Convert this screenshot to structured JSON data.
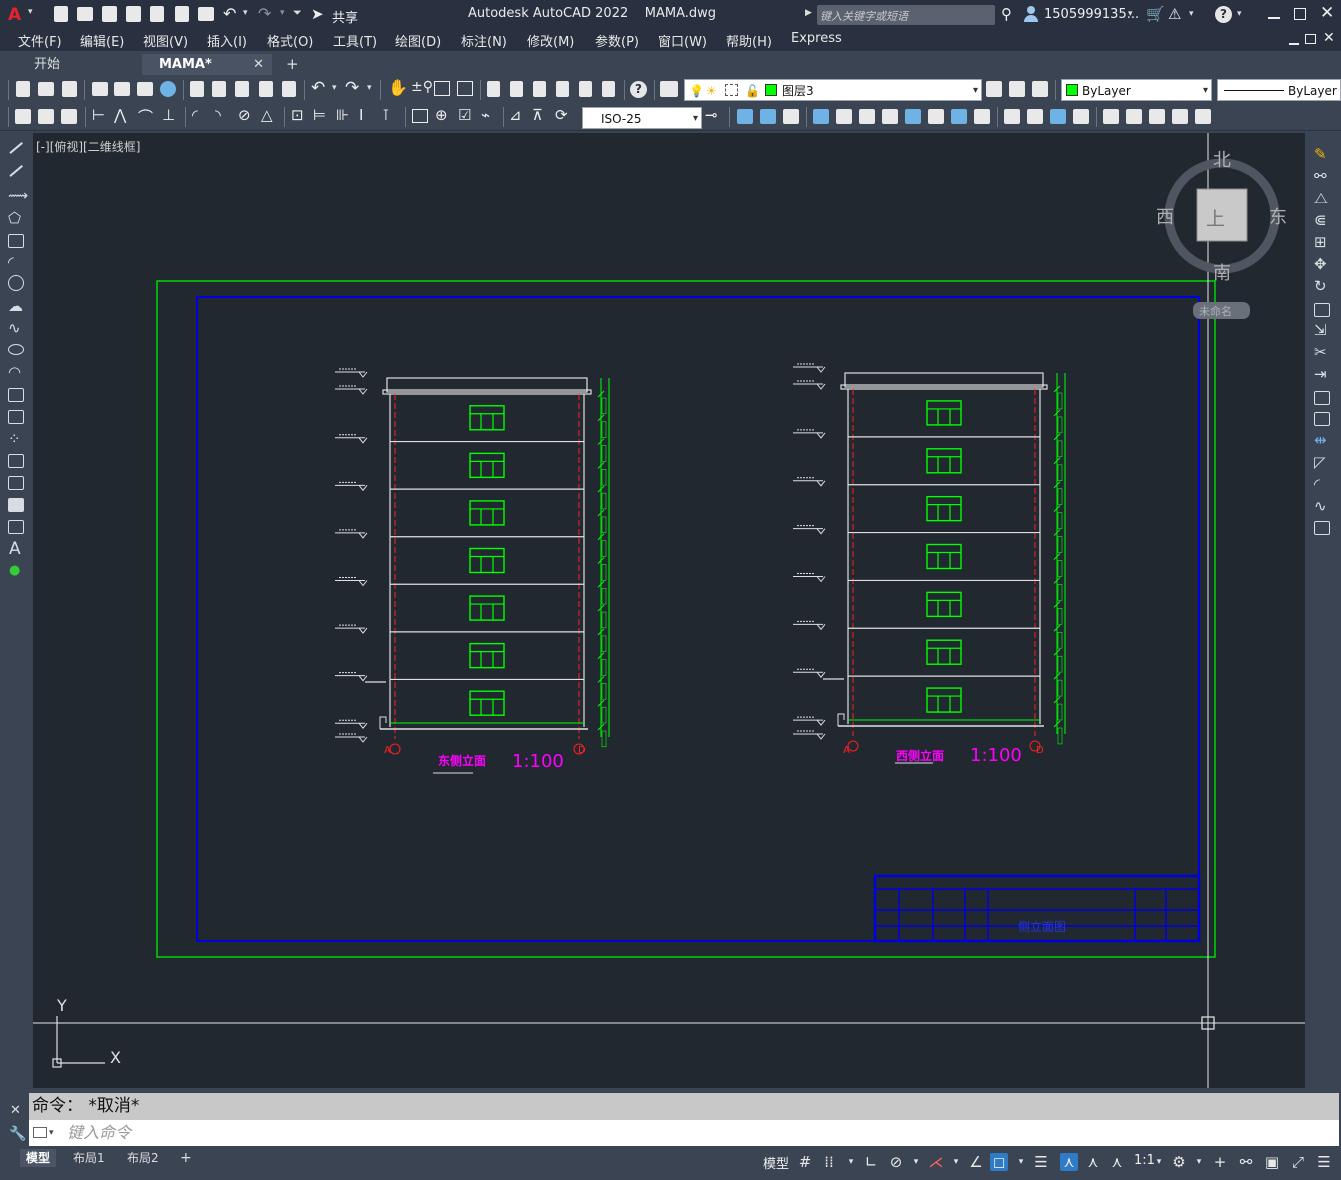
{
  "titlebar": {
    "title": "Autodesk AutoCAD 2022    MAMA.dwg",
    "share_label": "共享",
    "search_placeholder": "键入关键字或短语",
    "user_name": "1505999135...",
    "app_logo": "A"
  },
  "menubar": {
    "items": [
      "文件(F)",
      "编辑(E)",
      "视图(V)",
      "插入(I)",
      "格式(O)",
      "工具(T)",
      "绘图(D)",
      "标注(N)",
      "修改(M)",
      "参数(P)",
      "窗口(W)",
      "帮助(H)",
      "Express"
    ]
  },
  "tabs": {
    "start": "开始",
    "doc": "MAMA*",
    "add": "+"
  },
  "toolbar": {
    "layer_name": "图层3",
    "color_value": "ByLayer",
    "linetype_value": "ByLayer",
    "dimstyle_value": "ISO-25"
  },
  "viewport": {
    "label": "[-][俯视][二维线框]",
    "compass": {
      "north": "北",
      "south": "南",
      "west": "西",
      "east": "东",
      "top": "上"
    },
    "wcs_label": "未命名",
    "ucs_x": "X",
    "ucs_y": "Y"
  },
  "drawing": {
    "left_title": "东侧立面",
    "left_scale": "1:100",
    "right_title": "西侧立面",
    "right_scale": "1:100",
    "axis_a": "A",
    "axis_d": "D",
    "titleblock_name": "侧立面图",
    "colors": {
      "frame_outer": "#00d800",
      "frame_inner": "#0000e0",
      "window": "#00ff00",
      "title": "#ff00ff",
      "axis": "#ff2020"
    }
  },
  "command": {
    "history": "命令：  *取消*",
    "placeholder": "键入命令"
  },
  "statusbar": {
    "tabs": [
      "模型",
      "布局1",
      "布局2"
    ],
    "add": "+",
    "model_label": "模型",
    "scale_label": "1:1"
  }
}
